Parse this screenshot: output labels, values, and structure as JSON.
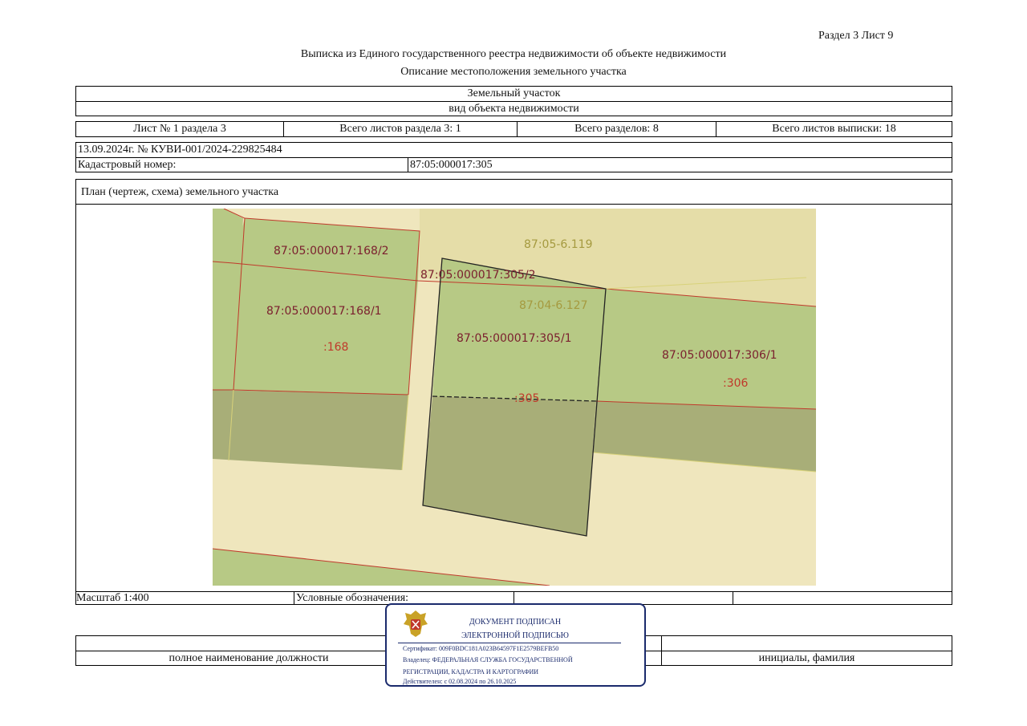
{
  "header": {
    "section_sheet": "Раздел 3   Лист 9",
    "title": "Выписка из Единого государственного реестра недвижимости об объекте недвижимости",
    "subtitle": "Описание местоположения земельного участка"
  },
  "object": {
    "type": "Земельный участок",
    "type_caption": "вид объекта недвижимости"
  },
  "sheets": {
    "sheet_of_section": "Лист № 1 раздела 3",
    "total_section_sheets": "Всего листов раздела 3: 1",
    "total_sections": "Всего разделов: 8",
    "total_extract_sheets": "Всего листов выписки: 18"
  },
  "record": {
    "date_number": "13.09.2024г. № КУВИ-001/2024-229825484",
    "cadastral_label": "Кадастровый номер:",
    "cadastral_value": "87:05:000017:305"
  },
  "plan": {
    "heading": "План (чертеж, схема) земельного участка",
    "labels": {
      "p168_2": "87:05:000017:168/2",
      "block_6_119": "87:05-6.119",
      "p305_2": "87:05:000017:305/2",
      "block_6_127": "87:04-6.127",
      "p168_1": "87:05:000017:168/1",
      "short_168": ":168",
      "p305_1": "87:05:000017:305/1",
      "p306_1": "87:05:000017:306/1",
      "short_306": ":306",
      "short_305": ":305"
    },
    "colors": {
      "background_land": "#efe6bd",
      "parcel_green": "#b7c985",
      "parcel_dark": "#a8ae78",
      "zone_tan": "#e5dda8",
      "boundary_red": "#c0392b",
      "label_red": "#c0392b",
      "label_dark": "#7b1f2e",
      "label_olive": "#a59a3f"
    }
  },
  "legend": {
    "scale": "Масштаб 1:400",
    "legend_label": "Условные обозначения:"
  },
  "signature": {
    "position_caption": "полное наименование должности",
    "name_caption": "инициалы, фамилия"
  },
  "stamp": {
    "line1": "ДОКУМЕНТ ПОДПИСАН",
    "line2": "ЭЛЕКТРОННОЙ ПОДПИСЬЮ",
    "certificate": "Сертификат: 009F0BDC181A023B64597F1E2579BEFB50",
    "owner_line1": "Владелец: ФЕДЕРАЛЬНАЯ СЛУЖБА ГОСУДАРСТВЕННОЙ",
    "owner_line2": "РЕГИСТРАЦИИ, КАДАСТРА И КАРТОГРАФИИ",
    "valid": "Действителен: с 02.08.2024 по 26.10.2025",
    "emblem_icon": "coat-of-arms-icon"
  }
}
